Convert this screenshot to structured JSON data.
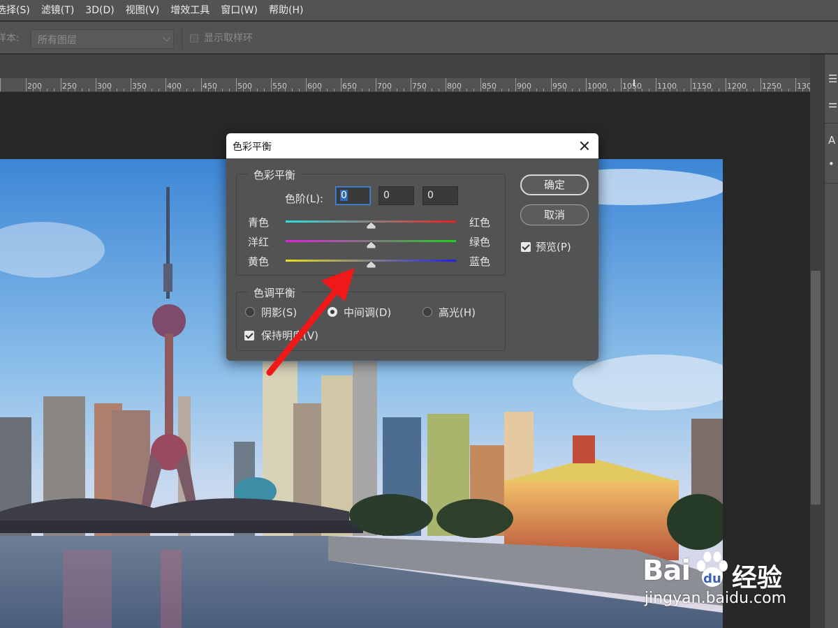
{
  "menubar": {
    "items": [
      "选择(S)",
      "滤镜(T)",
      "3D(D)",
      "视图(V)",
      "增效工具",
      "窗口(W)",
      "帮助(H)"
    ]
  },
  "options": {
    "sample_label": "样本:",
    "sample_value": "所有图层",
    "show_ring_label": "显示取样环"
  },
  "ruler": {
    "labels": [
      "200",
      "250",
      "300",
      "350",
      "400",
      "450",
      "500",
      "550",
      "600",
      "650",
      "700",
      "750",
      "800",
      "850",
      "900",
      "950",
      "1000",
      "1050",
      "1100",
      "1150",
      "1200",
      "1250",
      "1300"
    ]
  },
  "dialog": {
    "title": "色彩平衡",
    "color_balance_group": "色彩平衡",
    "levels_label": "色阶(L):",
    "levels": [
      "0",
      "0",
      "0"
    ],
    "sliders": [
      {
        "left": "青色",
        "right": "红色",
        "from": "#2ee0e0",
        "to": "#e82020",
        "value": 0
      },
      {
        "left": "洋红",
        "right": "绿色",
        "from": "#e020e0",
        "to": "#20d020",
        "value": 0
      },
      {
        "left": "黄色",
        "right": "蓝色",
        "from": "#e8e020",
        "to": "#2020e8",
        "value": 0
      }
    ],
    "tone_group": "色调平衡",
    "tones": [
      {
        "label": "阴影(S)",
        "checked": false
      },
      {
        "label": "中间调(D)",
        "checked": true
      },
      {
        "label": "高光(H)",
        "checked": false
      }
    ],
    "preserve_label": "保持明度(V)",
    "ok_label": "确定",
    "cancel_label": "取消",
    "preview_label": "预览(P)"
  },
  "watermark": {
    "brand": "Bai",
    "brand_cn": "经验",
    "url": "jingyan.baidu.com"
  },
  "colors": {
    "arrow": "#f01818",
    "panel": "#535353",
    "canvas": "#282828"
  }
}
